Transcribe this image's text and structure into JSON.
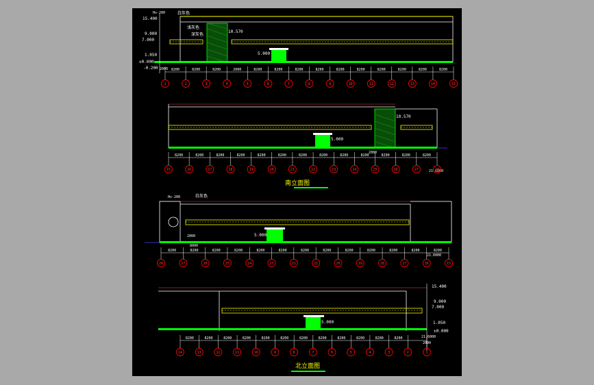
{
  "colors": {
    "background": "#a9a9a9",
    "drawing_bg": "#000000",
    "ground": "#00ff00",
    "outline": "#ffffff",
    "roof": "#ffff00",
    "grid_bubble": "#ff0000",
    "dimension": "#00ffff",
    "window": "#ffff00",
    "title": "#ffff00"
  },
  "elev1": {
    "level_top": "15.400",
    "hv_label": "Hv-200",
    "finish1": "白灰色",
    "finish2": "浅灰色",
    "finish3": "深灰色",
    "level_9": "9.000",
    "level_7": "7.000",
    "level_1": "1.050",
    "level_0": "±0.000",
    "level_neg": "-0.200",
    "level_5": "5.000",
    "level_10": "10.570",
    "first_dim": "2000",
    "dims": [
      "8200",
      "8200",
      "8200",
      "2000",
      "8200",
      "8200",
      "8200",
      "8200",
      "8200",
      "8200",
      "8200",
      "8200",
      "8200",
      "8200"
    ],
    "axes": [
      "1",
      "2",
      "3",
      "4",
      "5",
      "6",
      "7",
      "8",
      "9",
      "10",
      "11",
      "12",
      "13",
      "14",
      "15"
    ]
  },
  "elev2": {
    "title": "南立面图",
    "level_5": "5.000",
    "level_10": "10.570",
    "dim_2000": "2000",
    "total": "21.6000",
    "dims": [
      "8200",
      "8200",
      "8200",
      "8200",
      "8200",
      "8200",
      "8200",
      "8200",
      "8200",
      "8200",
      "8200",
      "8200",
      "8200"
    ],
    "axes": [
      "15",
      "16",
      "17",
      "18",
      "19",
      "20",
      "21",
      "22",
      "23",
      "24",
      "25",
      "26",
      "27",
      "28"
    ]
  },
  "elev3": {
    "hv_label": "Hv-200",
    "finish1": "白灰色",
    "level_5": "5.000",
    "dim_2000": "2000",
    "dim_8000": "8000",
    "total": "21.6000",
    "dims": [
      "8200",
      "8200",
      "8200",
      "8200",
      "8200",
      "8200",
      "8200",
      "8200",
      "8200",
      "8200",
      "8200",
      "8200",
      "8200"
    ],
    "axes": [
      "28",
      "27",
      "26",
      "25",
      "24",
      "23",
      "22",
      "21",
      "20",
      "19",
      "18",
      "17",
      "16",
      "15"
    ]
  },
  "elev4": {
    "title": "北立面图",
    "level_top": "15.400",
    "level_9": "9.000",
    "level_7": "7.000",
    "level_1": "1.050",
    "level_0": "±0.000",
    "level_5": "5.000",
    "dim_2000": "2000",
    "total": "21.6000",
    "dims": [
      "8200",
      "8200",
      "8200",
      "8200",
      "8200",
      "8200",
      "8200",
      "8200",
      "8200",
      "8200",
      "8200",
      "8200"
    ],
    "axes": [
      "14",
      "13",
      "12",
      "11",
      "10",
      "9",
      "8",
      "7",
      "6",
      "5",
      "4",
      "3",
      "2",
      "1"
    ]
  }
}
